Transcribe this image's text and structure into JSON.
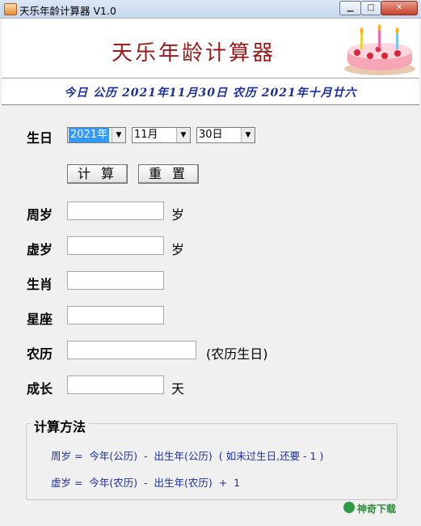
{
  "window": {
    "title": "天乐年龄计算器 V1.0",
    "controls": {
      "minimize": "▁",
      "maximize": "□",
      "close": "✕"
    }
  },
  "banner": {
    "title": "天乐年龄计算器",
    "image": "birthday-cake"
  },
  "today_line": "今日 公历 2021年11月30日 农历 2021年十月廿六",
  "birthday": {
    "label": "生日",
    "year": "2021年",
    "month": "11月",
    "day": "30日"
  },
  "buttons": {
    "calculate": "计 算",
    "reset": "重 置"
  },
  "fields": {
    "full_age": {
      "label": "周岁",
      "value": "",
      "unit": "岁"
    },
    "nominal_age": {
      "label": "虚岁",
      "value": "",
      "unit": "岁"
    },
    "zodiac": {
      "label": "生肖",
      "value": ""
    },
    "constellation": {
      "label": "星座",
      "value": ""
    },
    "lunar": {
      "label": "农历",
      "value": "",
      "suffix": "(农历生日)"
    },
    "growth": {
      "label": "成长",
      "value": "",
      "unit": "天"
    }
  },
  "method": {
    "title": "计算方法",
    "line1": "周岁 =  今年(公历)  -  出生年(公历)  ( 如未过生日,还要 - 1 )",
    "line2": "虚岁 =  今年(农历)  -  出生年(农历)  +  1"
  },
  "watermark": "神奇下载",
  "colors": {
    "title_red": "#9a1a1a",
    "date_blue": "#1a2fa0",
    "select_highlight": "#3399ff"
  }
}
